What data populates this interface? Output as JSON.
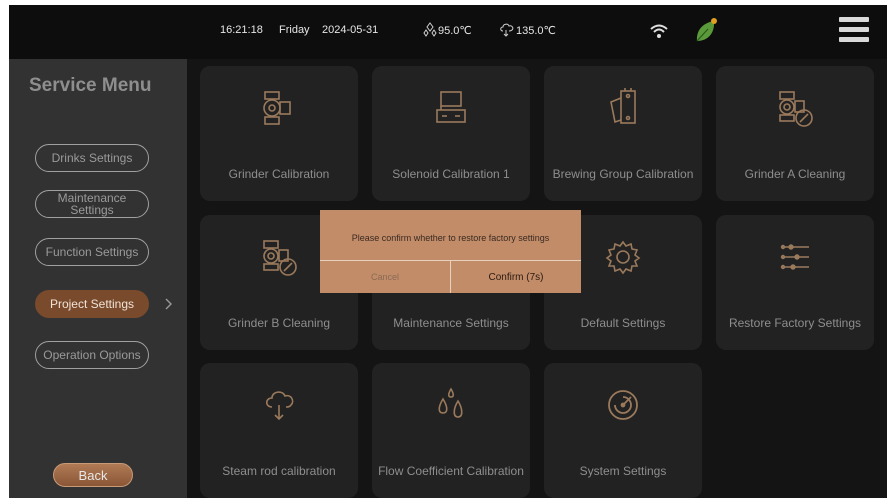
{
  "status_bar": {
    "time": "16:21:18",
    "day": "Friday",
    "date": "2024-05-31",
    "temp_1": "95.0℃",
    "temp_2": "135.0℃"
  },
  "sidebar": {
    "title": "Service Menu",
    "items": [
      {
        "label": "Drinks Settings",
        "active": false
      },
      {
        "label": "Maintenance Settings",
        "active": false
      },
      {
        "label": "Function Settings",
        "active": false
      },
      {
        "label": "Project Settings",
        "active": true
      },
      {
        "label": "Operation Options",
        "active": false
      }
    ],
    "back_label": "Back"
  },
  "tiles": [
    {
      "label": "Grinder Calibration",
      "icon": "grinder-icon"
    },
    {
      "label": "Solenoid Calibration 1",
      "icon": "solenoid-icon"
    },
    {
      "label": "Brewing Group Calibration",
      "icon": "brewing-group-icon"
    },
    {
      "label": "Grinder A Cleaning",
      "icon": "grinder-cleaning-icon"
    },
    {
      "label": "Grinder B Cleaning",
      "icon": "grinder-cleaning-icon"
    },
    {
      "label": "Maintenance Settings",
      "icon": "maintenance-icon"
    },
    {
      "label": "Default Settings",
      "icon": "gear-icon"
    },
    {
      "label": "Restore Factory Settings",
      "icon": "sliders-icon"
    },
    {
      "label": "Steam rod calibration",
      "icon": "steam-icon"
    },
    {
      "label": "Flow Coefficient Calibration",
      "icon": "droplets-icon"
    },
    {
      "label": "System Settings",
      "icon": "radar-icon"
    }
  ],
  "dialog": {
    "message": "Please confirm whether to restore factory settings",
    "cancel_label": "Cancel",
    "confirm_label": "Confirm  (7s)"
  },
  "colors": {
    "accent": "#7a4a2c",
    "dialog_bg": "#c28c69",
    "icon_color": "#9b7a5c",
    "leaf_green": "#5a9a3a"
  }
}
